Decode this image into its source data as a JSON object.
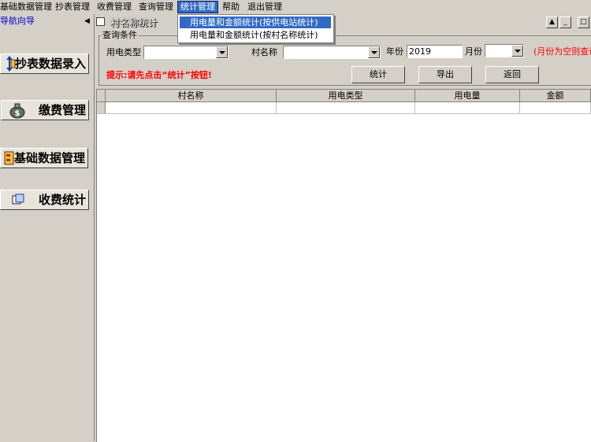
{
  "menubar": {
    "items": [
      "基础数据管理",
      "抄表管理",
      "收费管理",
      "查询管理",
      "统计管理",
      "帮助",
      "退出管理"
    ],
    "active_index": 4
  },
  "dropdown": {
    "items": [
      "用电量和金额统计(按供电站统计)",
      "用电量和金额统计(按村名称统计)"
    ],
    "selected_index": 0
  },
  "nav": {
    "title": "导航向导",
    "buttons": [
      "抄表数据录入",
      "缴费管理",
      "基础数据管理",
      "收费统计"
    ]
  },
  "window": {
    "title": "村名称统计"
  },
  "query": {
    "group_label": "查询条件",
    "power_type_label": "用电类型",
    "power_type_value": "",
    "village_label": "村名称",
    "village_value": "",
    "year_label": "年份",
    "year_value": "2019",
    "month_label": "月份",
    "month_value": "",
    "month_note": "(月份为空则查询",
    "hint": "提示:请先点击“统计”按钮!",
    "stat_button": "统计",
    "export_button": "导出",
    "back_button": "返回"
  },
  "grid": {
    "columns": [
      "村名称",
      "用电类型",
      "用电量",
      "金额"
    ]
  },
  "colors": {
    "highlight": "#316ac5",
    "hint": "#ff0000",
    "nav_title": "#0000cc"
  }
}
